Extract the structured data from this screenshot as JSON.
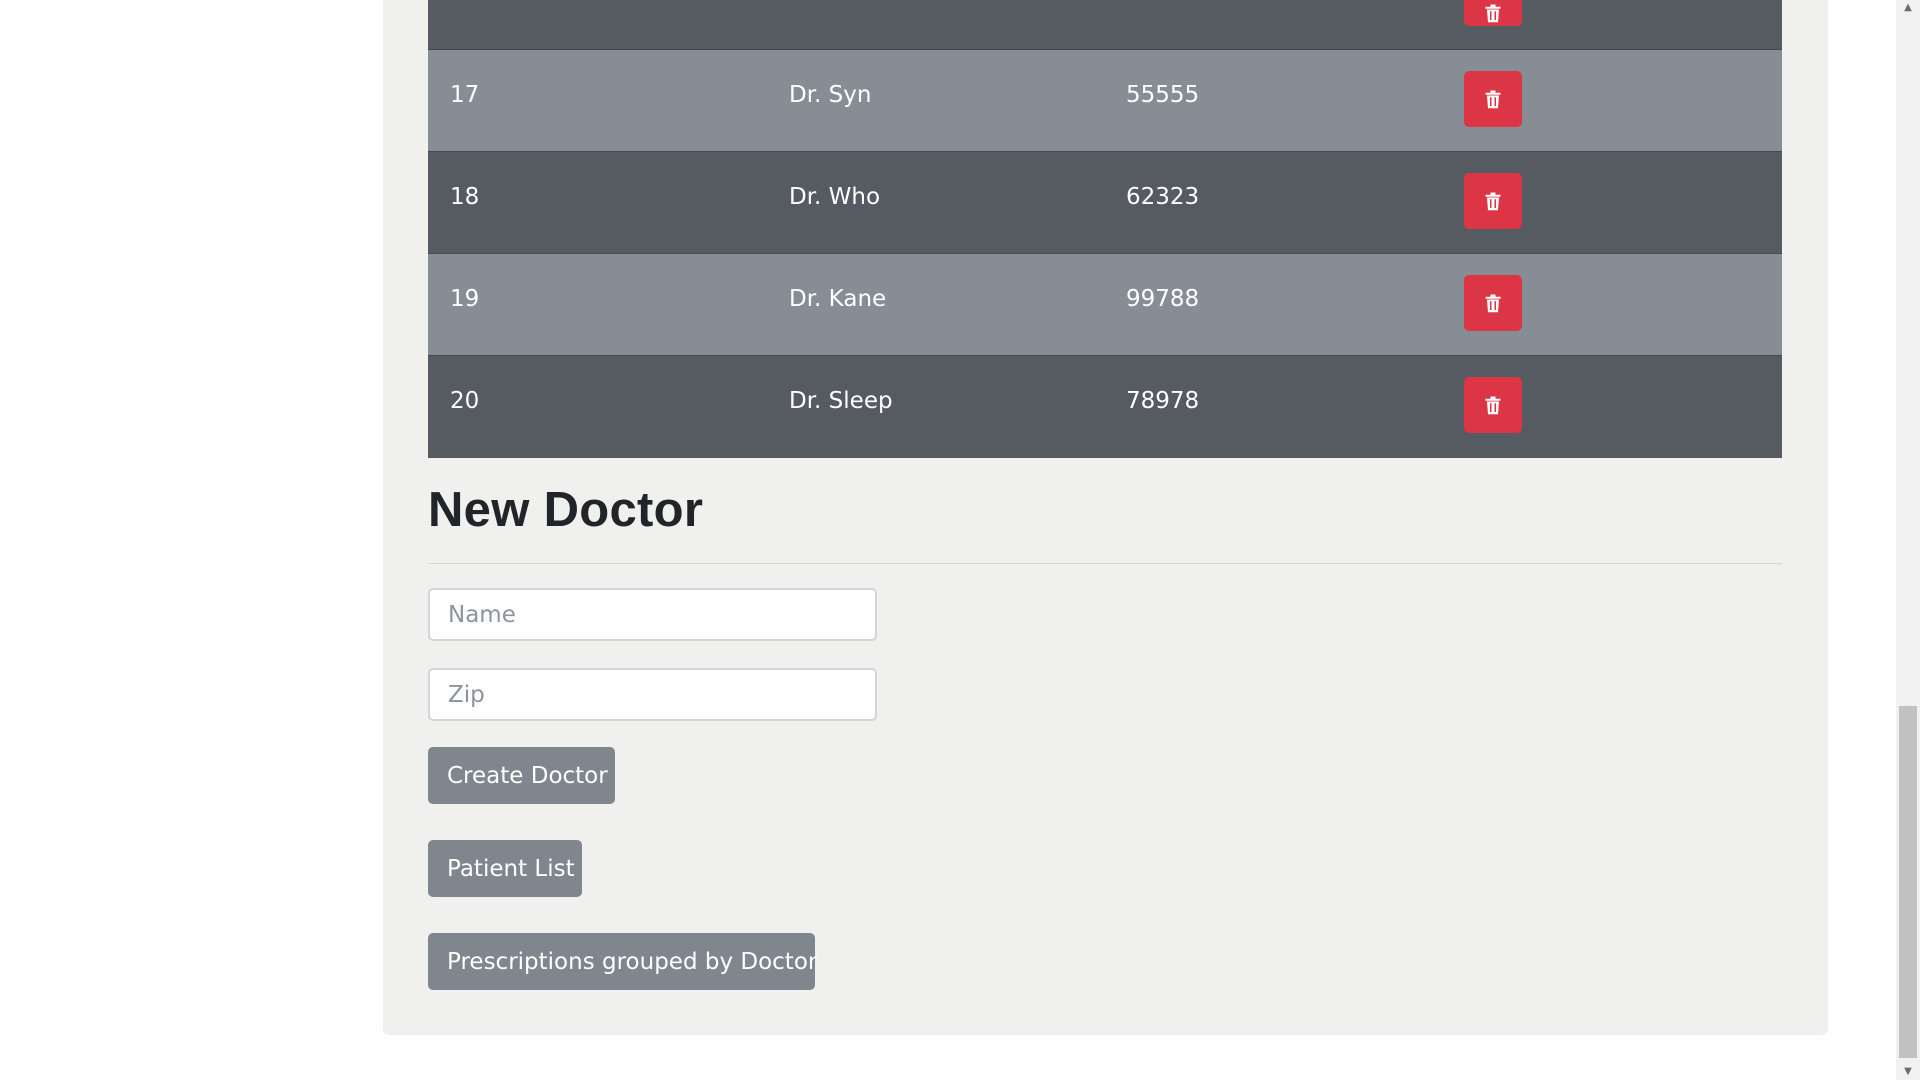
{
  "doctors_table": {
    "rows": [
      {
        "id": "",
        "name": "",
        "zip": ""
      },
      {
        "id": "17",
        "name": "Dr. Syn",
        "zip": "55555"
      },
      {
        "id": "18",
        "name": "Dr. Who",
        "zip": "62323"
      },
      {
        "id": "19",
        "name": "Dr. Kane",
        "zip": "99788"
      },
      {
        "id": "20",
        "name": "Dr. Sleep",
        "zip": "78978"
      }
    ],
    "delete_icon": "trash-icon"
  },
  "new_doctor": {
    "heading": "New Doctor",
    "name_placeholder": "Name",
    "zip_placeholder": "Zip",
    "create_label": "Create Doctor"
  },
  "nav": {
    "patient_list_label": "Patient List",
    "prescriptions_label": "Prescriptions grouped by Doctor"
  },
  "colors": {
    "row_dark": "#565a61",
    "row_light": "#878d94",
    "danger": "#dc3545",
    "secondary_button": "#7f868d",
    "card_background": "#f0f0ef"
  }
}
